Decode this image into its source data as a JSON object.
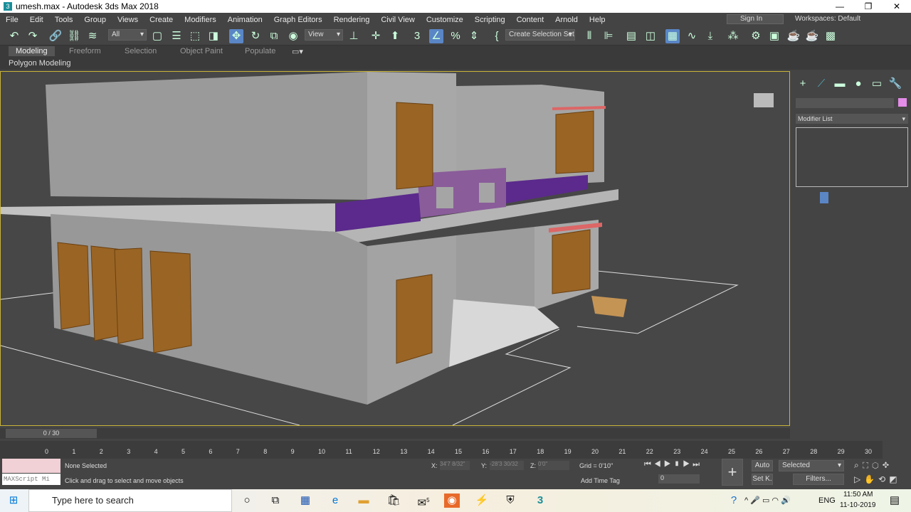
{
  "window": {
    "title": "umesh.max - Autodesk 3ds Max 2018",
    "minimize": "—",
    "maximize": "❐",
    "close": "✕"
  },
  "menu": [
    "File",
    "Edit",
    "Tools",
    "Group",
    "Views",
    "Create",
    "Modifiers",
    "Animation",
    "Graph Editors",
    "Rendering",
    "Civil View",
    "Customize",
    "Scripting",
    "Content",
    "Arnold",
    "Help"
  ],
  "account": {
    "signin": "Sign In",
    "workspaces_label": "Workspaces:",
    "workspace": "Default"
  },
  "toolbar": {
    "selection_filter": "All",
    "ref_coord": "View",
    "named_selection": "Create Selection Set"
  },
  "ribbon": {
    "tabs": [
      "Modeling",
      "Freeform",
      "Selection",
      "Object Paint",
      "Populate"
    ],
    "active": "Modeling",
    "sub": "Polygon Modeling"
  },
  "command_panel": {
    "modifier_list": "Modifier List"
  },
  "timeline": {
    "frame": "0 / 30",
    "ticks": [
      "0",
      "1",
      "2",
      "3",
      "4",
      "5",
      "6",
      "7",
      "8",
      "9",
      "10",
      "11",
      "12",
      "13",
      "14",
      "15",
      "16",
      "17",
      "18",
      "19",
      "20",
      "21",
      "22",
      "23",
      "24",
      "25",
      "26",
      "27",
      "28",
      "29",
      "30"
    ]
  },
  "status": {
    "maxscript": "MAXScript Mi",
    "selection": "None Selected",
    "prompt": "Click and drag to select and move objects",
    "x_label": "X:",
    "x": "34'7 8/32\"",
    "y_label": "Y:",
    "y": "-28'3 30/32",
    "z_label": "Z:",
    "z": "0'0\"",
    "grid": "Grid = 0'10\"",
    "add_time_tag": "Add Time Tag",
    "frame_field": "0",
    "auto": "Auto",
    "setkey": "Set K.",
    "key_filter": "Selected",
    "filters": "Filters..."
  },
  "taskbar": {
    "search_placeholder": "Type here to search",
    "mail_badge": "5",
    "lang": "ENG",
    "time": "11:50 AM",
    "date": "11-10-2019"
  },
  "colors": {
    "accent": "#5a86c6",
    "viewport_border": "#c9b33a",
    "door": "#9a6424",
    "purple": "#6a2b9a"
  }
}
